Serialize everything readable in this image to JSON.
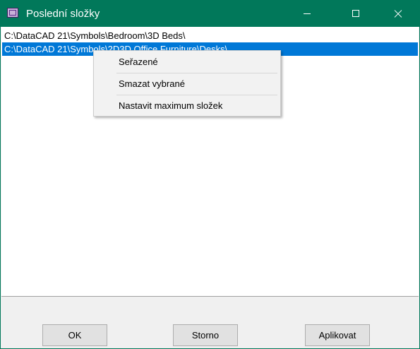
{
  "window": {
    "title": "Poslední složky",
    "colors": {
      "titlebar": "#01785a",
      "selection": "#0078d7"
    }
  },
  "titlebar": {
    "icons": {
      "app": "datacad-app-icon",
      "minimize": "minimize-icon",
      "maximize": "maximize-icon",
      "close": "close-icon"
    }
  },
  "list": {
    "items": [
      {
        "path": "C:\\DataCAD 21\\Symbols\\Bedroom\\3D Beds\\",
        "selected": false
      },
      {
        "path": "C:\\DataCAD 21\\Symbols\\2D3D Office Furniture\\Desks\\",
        "selected": true
      }
    ]
  },
  "context_menu": {
    "items": [
      {
        "label": "Seřazené"
      },
      {
        "label": "Smazat vybrané"
      },
      {
        "label": "Nastavit maximum složek"
      }
    ]
  },
  "buttons": {
    "ok": "OK",
    "cancel": "Storno",
    "apply": "Aplikovat"
  }
}
